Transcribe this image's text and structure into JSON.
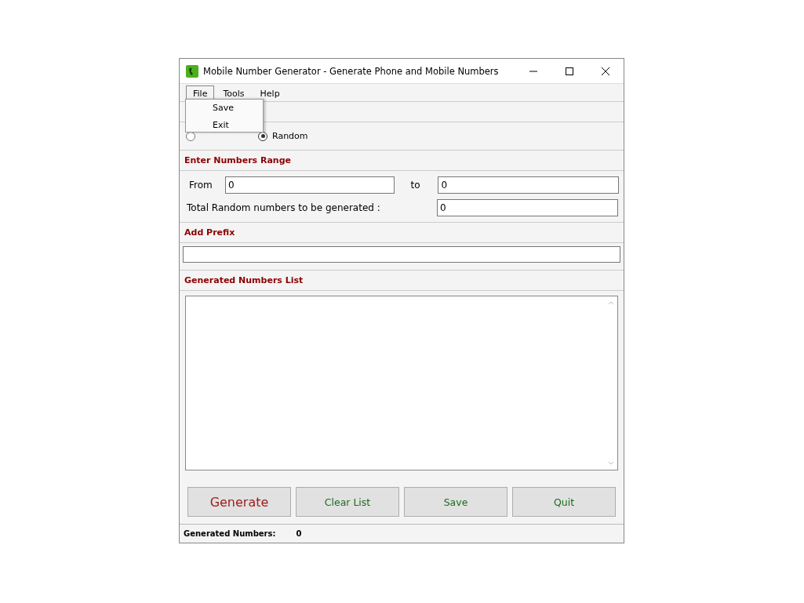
{
  "window": {
    "title": "Mobile Number Generator - Generate Phone and Mobile Numbers"
  },
  "menu": [
    {
      "label": "File",
      "selected": true
    },
    {
      "label": "Tools",
      "selected": false
    },
    {
      "label": "Help",
      "selected": false
    }
  ],
  "file_menu": [
    "Save",
    "Exit"
  ],
  "mode": [
    {
      "selected": false
    },
    {
      "label": "Random",
      "selected": true
    }
  ],
  "range": {
    "title": "Enter Numbers Range",
    "from_label": "From",
    "from_value": "0",
    "to_label": "to",
    "to_value": "0",
    "total_label": "Total Random numbers to be generated :",
    "total_value": "0"
  },
  "prefix": {
    "title": "Add Prefix"
  },
  "list": {
    "title": "Generated Numbers List"
  },
  "buttons": [
    {
      "label": "Generate",
      "kind": "primary"
    },
    {
      "label": "Clear List",
      "kind": "normal"
    },
    {
      "label": "Save",
      "kind": "normal"
    },
    {
      "label": "Quit",
      "kind": "normal"
    }
  ],
  "status_bar": {
    "label": "Generated Numbers:",
    "value": "0"
  }
}
